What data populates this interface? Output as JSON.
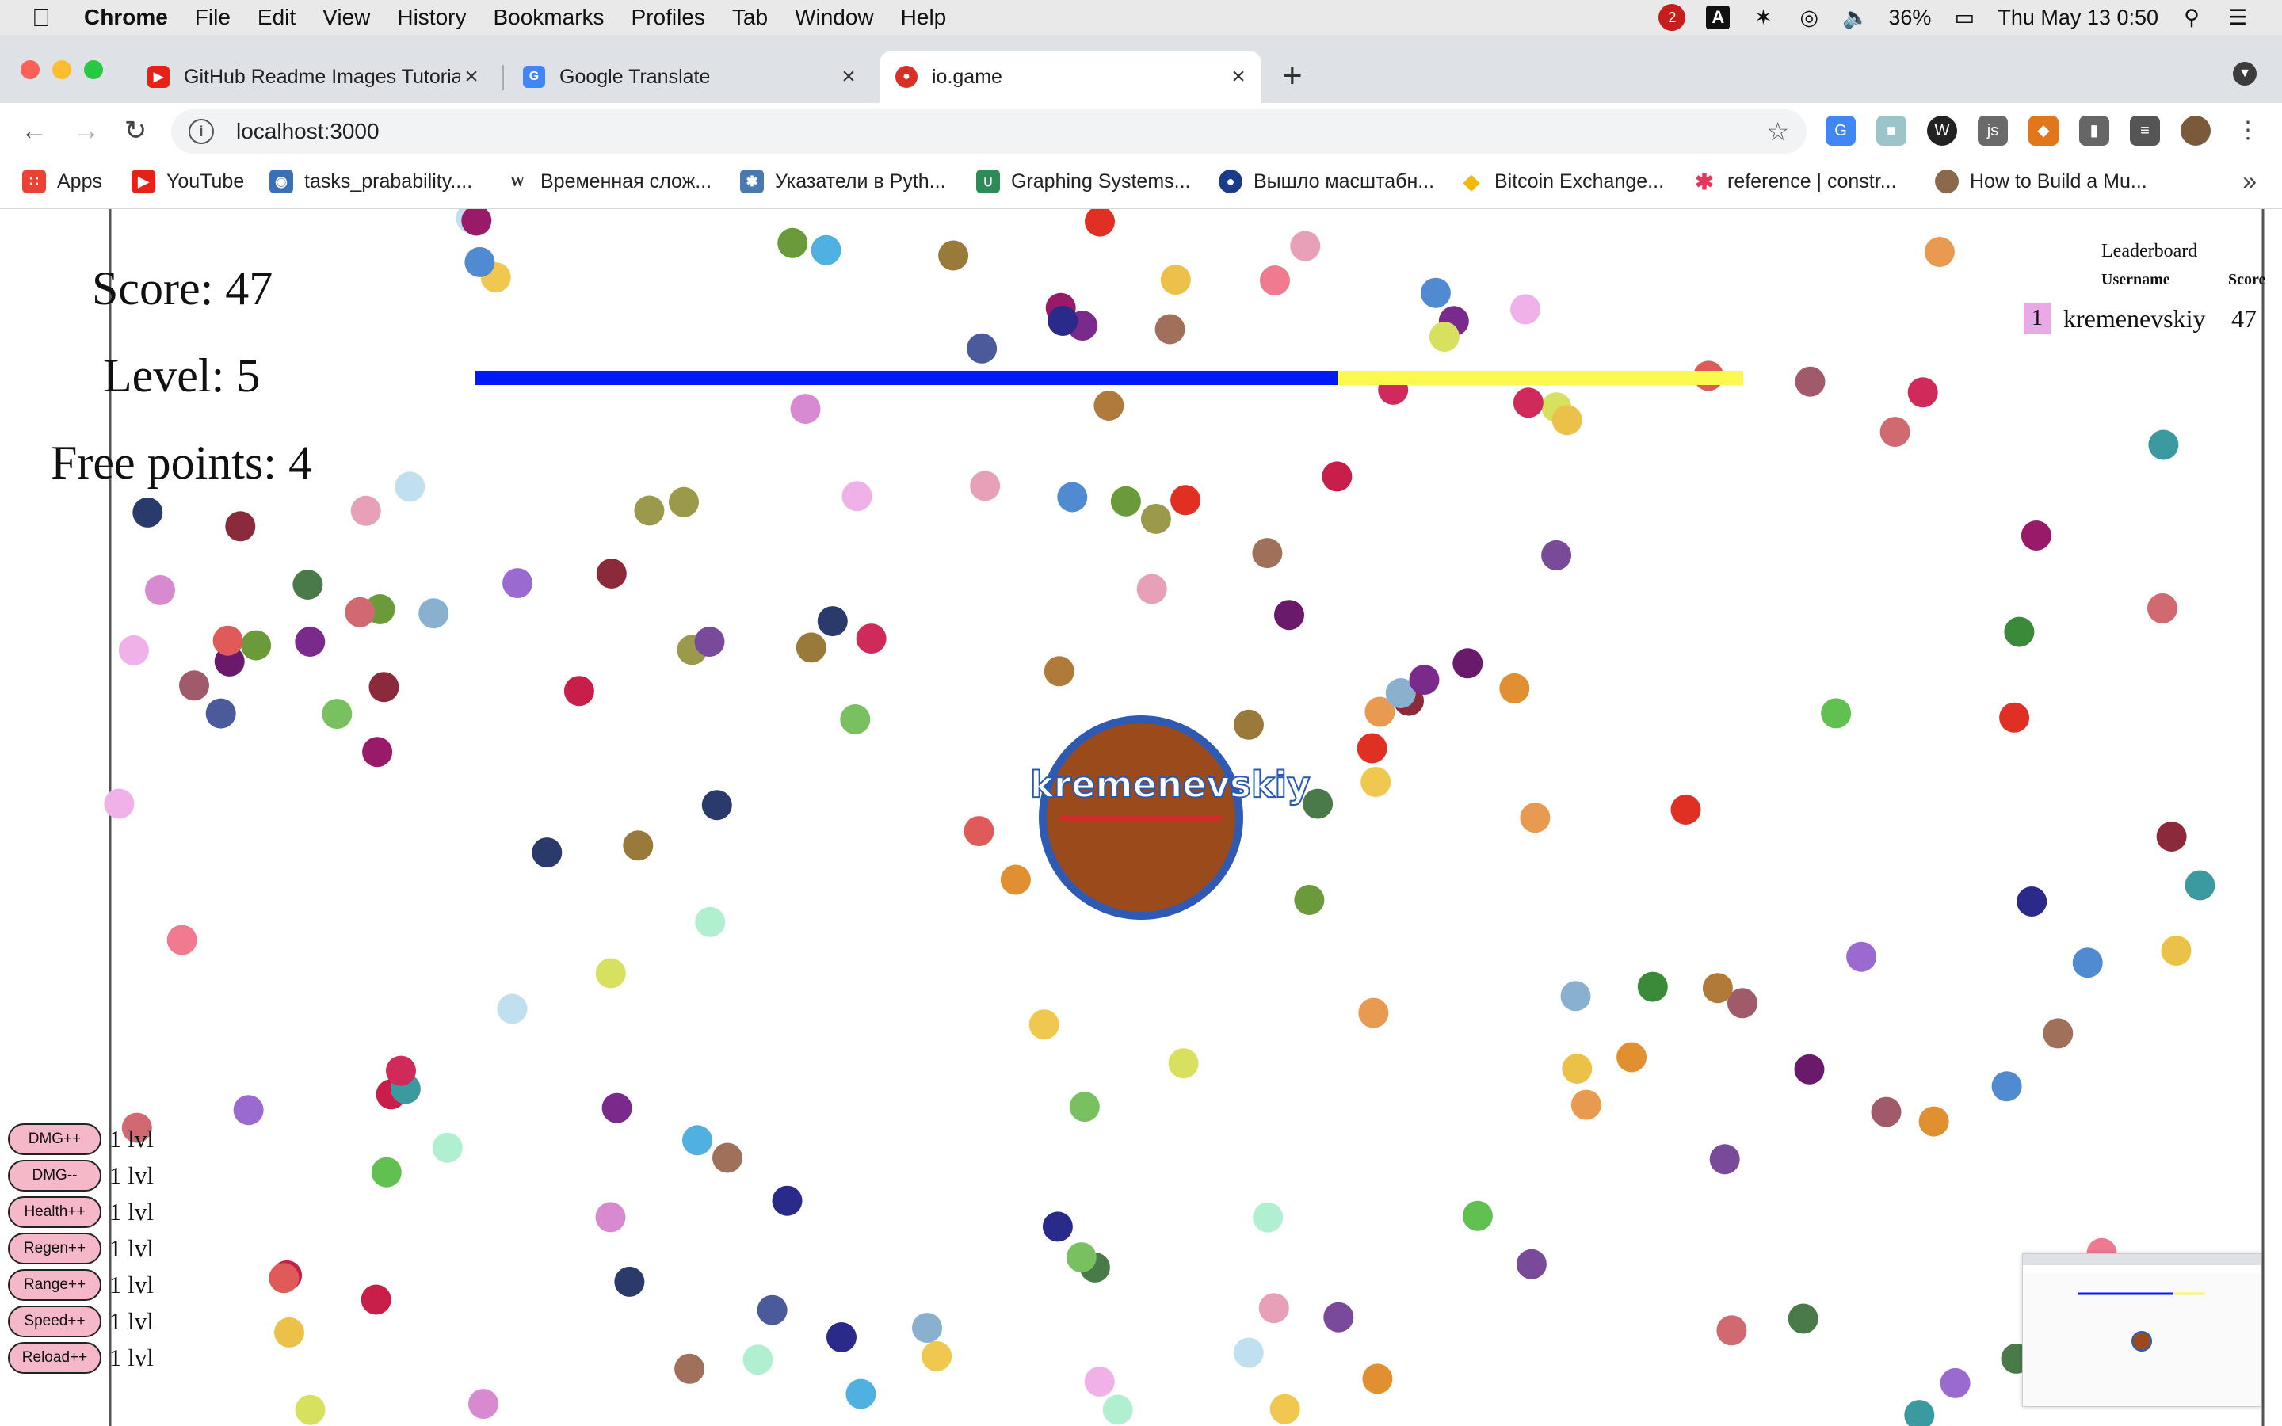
{
  "menubar": {
    "app_name": "Chrome",
    "items": [
      "File",
      "Edit",
      "View",
      "History",
      "Bookmarks",
      "Profiles",
      "Tab",
      "Window",
      "Help"
    ],
    "badge_count": "2",
    "battery": "36%",
    "clock": "Thu May 13  0:50"
  },
  "tabs": [
    {
      "title": "GitHub Readme Images Tutoria",
      "favicon": "youtube-icon",
      "color": "#e62117"
    },
    {
      "title": "Google Translate",
      "favicon": "translate-icon",
      "color": "#4285f4"
    },
    {
      "title": "io.game",
      "favicon": "game-icon",
      "color": "#d93025"
    }
  ],
  "address": {
    "url": "localhost:3000"
  },
  "bookmarks": [
    {
      "label": "Apps",
      "icon": "apps-grid-icon",
      "color": "#ea4335"
    },
    {
      "label": "YouTube",
      "icon": "youtube-icon",
      "color": "#e62117"
    },
    {
      "label": "tasks_prabability....",
      "icon": "tasks-icon",
      "color": "#3b6fb6"
    },
    {
      "label": "Временная слож...",
      "icon": "wikipedia-icon",
      "color": "#333333"
    },
    {
      "label": "Указатели в Pyth...",
      "icon": "pointer-icon",
      "color": "#4a78b0"
    },
    {
      "label": "Graphing Systems...",
      "icon": "graph-icon",
      "color": "#2e8b57"
    },
    {
      "label": "Вышло масштабн...",
      "icon": "news-icon",
      "color": "#1a3a8a"
    },
    {
      "label": "Bitcoin Exchange...",
      "icon": "binance-icon",
      "color": "#f0b90b"
    },
    {
      "label": "reference | constr...",
      "icon": "cplusplus-icon",
      "color": "#e8345a"
    },
    {
      "label": "How to Build a Mu...",
      "icon": "avatar-icon",
      "color": "#8a6a4a"
    }
  ],
  "game": {
    "score_label": "Score: 47",
    "level_label": "Level: 5",
    "free_points_label": "Free points: 4",
    "progress": {
      "filled_fraction": 0.68,
      "fill_color": "#0019f5",
      "rest_color": "#fbf94d"
    },
    "player": {
      "name": "kremenevskiy",
      "body_color": "#9b4a1c",
      "outline_color": "#2f5ab3",
      "health_fraction": 1.0
    },
    "leaderboard": {
      "title": "Leaderboard",
      "headers": {
        "username": "Username",
        "score": "Score"
      },
      "rows": [
        {
          "rank": "1",
          "username": "kremenevskiy",
          "score": "47"
        }
      ]
    },
    "upgrades": [
      {
        "label": "DMG++",
        "level": "1 lvl"
      },
      {
        "label": "DMG--",
        "level": "1 lvl"
      },
      {
        "label": "Health++",
        "level": "1 lvl"
      },
      {
        "label": "Regen++",
        "level": "1 lvl"
      },
      {
        "label": "Range++",
        "level": "1 lvl"
      },
      {
        "label": "Speed++",
        "level": "1 lvl"
      },
      {
        "label": "Reload++",
        "level": "1 lvl"
      }
    ],
    "food_colors": [
      "#b07a3a",
      "#e8a0b8",
      "#9a7a3a",
      "#c81e4a",
      "#e89a50",
      "#a0705a",
      "#f0b0e8",
      "#e03024",
      "#d8e060",
      "#4a7a4a",
      "#f0c850",
      "#60c050",
      "#9a1a6a",
      "#3a9aa0",
      "#e09030",
      "#7a4a9a",
      "#d88ad0",
      "#508ad0",
      "#6a1a6a",
      "#b0f0d0",
      "#d02a5a",
      "#ecc14a",
      "#2a3a6a",
      "#6a9a3a",
      "#8a2a3a",
      "#a05a6a",
      "#c0e0f0",
      "#7a2a8a",
      "#4a5a9a",
      "#8ab0d0",
      "#d06a70",
      "#78c060",
      "#2a2a8a",
      "#3a8a3a",
      "#9a9a4a",
      "#e05a5a",
      "#50b0e0",
      "#9a6ad0",
      "#f07a90"
    ]
  }
}
